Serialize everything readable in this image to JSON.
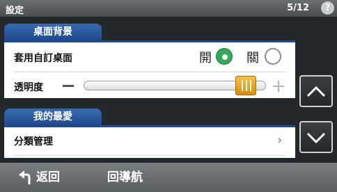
{
  "titlebar": {
    "title": "設定",
    "page": "5/12",
    "help_glyph": "?"
  },
  "sections": [
    {
      "header": "桌面背景",
      "rows": [
        {
          "label": "套用自訂桌面",
          "options": [
            "開",
            "關"
          ],
          "selected": "開"
        },
        {
          "label": "透明度",
          "slider_value_fraction": 0.94
        }
      ]
    },
    {
      "header": "我的最愛",
      "rows": [
        {
          "label": "分類管理",
          "chevron": "›"
        }
      ]
    }
  ],
  "side_buttons": {
    "up_icon": "chevron-up-icon",
    "down_icon": "chevron-down-icon"
  },
  "bottom": {
    "back_label": "返回",
    "nav_label": "回導航",
    "back_icon": "back-arrow-icon"
  },
  "colors": {
    "accent_blue": "#1f4a8c",
    "radio_on": "#36a85a",
    "slider_thumb": "#e8a820"
  }
}
